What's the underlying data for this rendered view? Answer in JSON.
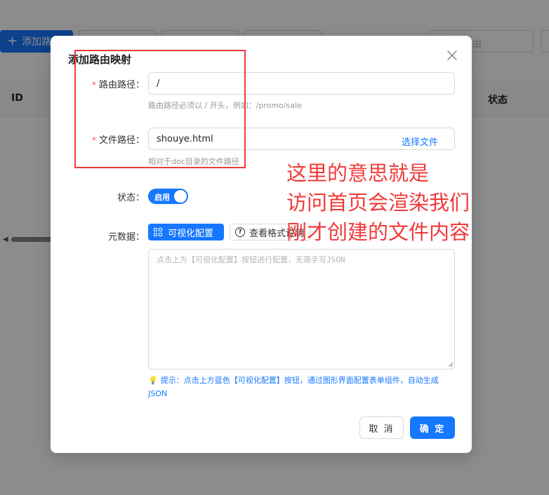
{
  "background": {
    "add_button_label": "添加路",
    "search_placeholder": "由",
    "table_headers": {
      "id": "ID",
      "status": "状态"
    }
  },
  "modal": {
    "title": "添加路由映射",
    "route_path": {
      "label": "路由路径：",
      "value": "/",
      "hint": "路由路径必须以 / 开头，例如：/promo/sale"
    },
    "file_path": {
      "label": "文件路径：",
      "value": "shouye.html",
      "choose_label": "选择文件",
      "hint": "相对于doc目录的文件路径"
    },
    "status": {
      "label": "状态：",
      "switch_label": "启用",
      "enabled": true
    },
    "metadata": {
      "label": "元数据：",
      "visual_config_button": "可视化配置",
      "view_format_button": "查看格式说明",
      "textarea_placeholder": "点击上方【可视化配置】按钮进行配置，无需手写JSON",
      "tip": "提示：点击上方蓝色【可视化配置】按钮，通过图形界面配置表单组件，自动生成JSON"
    },
    "cancel_label": "取 消",
    "ok_label": "确 定"
  },
  "annotation": {
    "lines": [
      "这里的意思就是",
      "访问首页会渲染我们",
      "刚才创建的文件内容"
    ]
  },
  "colors": {
    "primary": "#1677ff",
    "annotation_red": "#f03a3a",
    "required_star": "#ff4d4f"
  }
}
